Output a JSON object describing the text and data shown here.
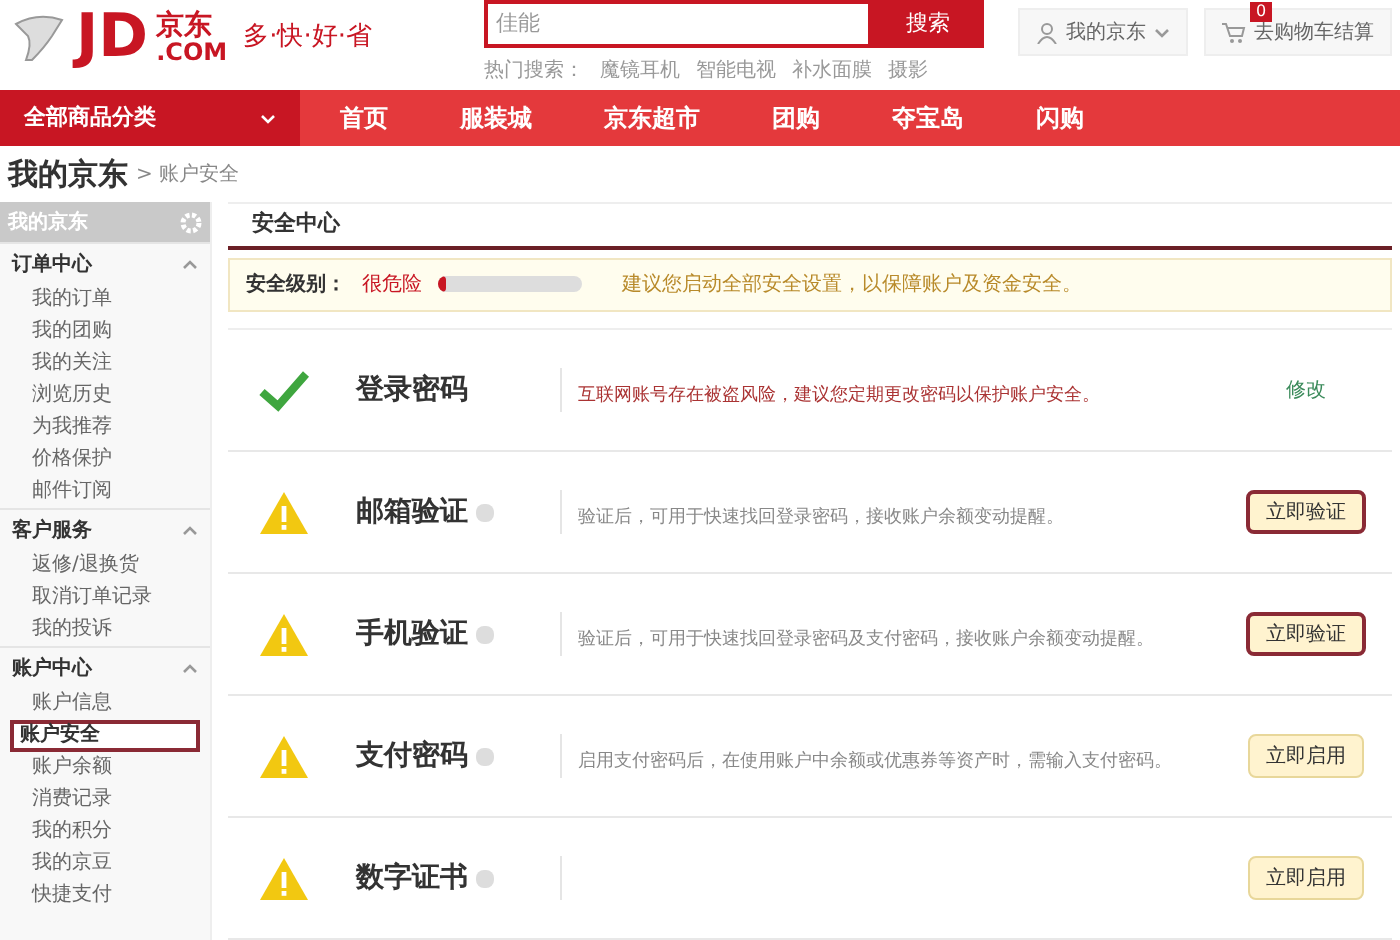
{
  "header": {
    "logo": {
      "mark": "JD",
      "domain": ".COM",
      "name": "京东"
    },
    "slogan": "多·快·好·省",
    "search": {
      "placeholder": "佳能",
      "button": "搜索"
    },
    "hot_label": "热门搜索：",
    "hot_terms": [
      "魔镜耳机",
      "智能电视",
      "补水面膜",
      "摄影"
    ],
    "my_jd": "我的京东",
    "cart": {
      "label": "去购物车结算",
      "count": "0"
    }
  },
  "nav": {
    "category": "全部商品分类",
    "items": [
      {
        "label": "首页",
        "selected": false
      },
      {
        "label": "服装城",
        "selected": false
      },
      {
        "label": "京东超市",
        "selected": false
      },
      {
        "label": "团购",
        "selected": false
      },
      {
        "label": "夺宝岛",
        "selected": false
      },
      {
        "label": "闪购",
        "selected": false
      }
    ]
  },
  "breadcrumb": {
    "title": "我的京东",
    "current": "> 账户安全"
  },
  "sidebar": {
    "title": "我的京东",
    "groups": [
      {
        "label": "订单中心",
        "expanded": true,
        "items": [
          {
            "label": "我的订单",
            "selected": false
          },
          {
            "label": "我的团购",
            "selected": false
          },
          {
            "label": "我的关注",
            "selected": false
          },
          {
            "label": "浏览历史",
            "selected": false
          },
          {
            "label": "为我推荐",
            "selected": false
          },
          {
            "label": "价格保护",
            "selected": false
          },
          {
            "label": "邮件订阅",
            "selected": false
          }
        ]
      },
      {
        "label": "客户服务",
        "expanded": true,
        "items": [
          {
            "label": "返修/退换货",
            "selected": false
          },
          {
            "label": "取消订单记录",
            "selected": false
          },
          {
            "label": "我的投诉",
            "selected": false
          }
        ]
      },
      {
        "label": "账户中心",
        "expanded": true,
        "items": [
          {
            "label": "账户信息",
            "selected": false
          },
          {
            "label": "账户安全",
            "selected": true
          },
          {
            "label": "账户余额",
            "selected": false
          },
          {
            "label": "消费记录",
            "selected": false
          },
          {
            "label": "我的积分",
            "selected": false
          },
          {
            "label": "我的京豆",
            "selected": false
          },
          {
            "label": "快捷支付",
            "selected": false
          }
        ]
      }
    ]
  },
  "content": {
    "title": "安全中心",
    "level": {
      "label": "安全级别：",
      "value": "很危险",
      "level": 0.05,
      "advice": "建议您启动全部安全设置，以保障账户及资金安全。"
    },
    "rows": [
      {
        "title": "登录密码",
        "kind": "ok",
        "badge": false,
        "description": "互联网账号存在被盗风险，建议您定期更改密码以保护账户安全。",
        "action": {
          "kind": "link",
          "label": "修改",
          "highlighted": false
        }
      },
      {
        "title": "邮箱验证",
        "kind": "warning",
        "badge": true,
        "description": "验证后，可用于快速找回登录密码，接收账户余额变动提醒。",
        "action": {
          "kind": "button",
          "label": "立即验证",
          "highlighted": true
        }
      },
      {
        "title": "手机验证",
        "kind": "warning",
        "badge": true,
        "description": "验证后，可用于快速找回登录密码及支付密码，接收账户余额变动提醒。",
        "action": {
          "kind": "button",
          "label": "立即验证",
          "highlighted": true
        }
      },
      {
        "title": "支付密码",
        "kind": "warning",
        "badge": true,
        "description": "启用支付密码后，在使用账户中余额或优惠券等资产时，需输入支付密码。",
        "action": {
          "kind": "button",
          "label": "立即启用",
          "highlighted": false
        }
      },
      {
        "title": "数字证书",
        "kind": "warning",
        "badge": true,
        "action": {
          "kind": "button",
          "label": "立即启用",
          "highlighted": false
        }
      }
    ]
  }
}
